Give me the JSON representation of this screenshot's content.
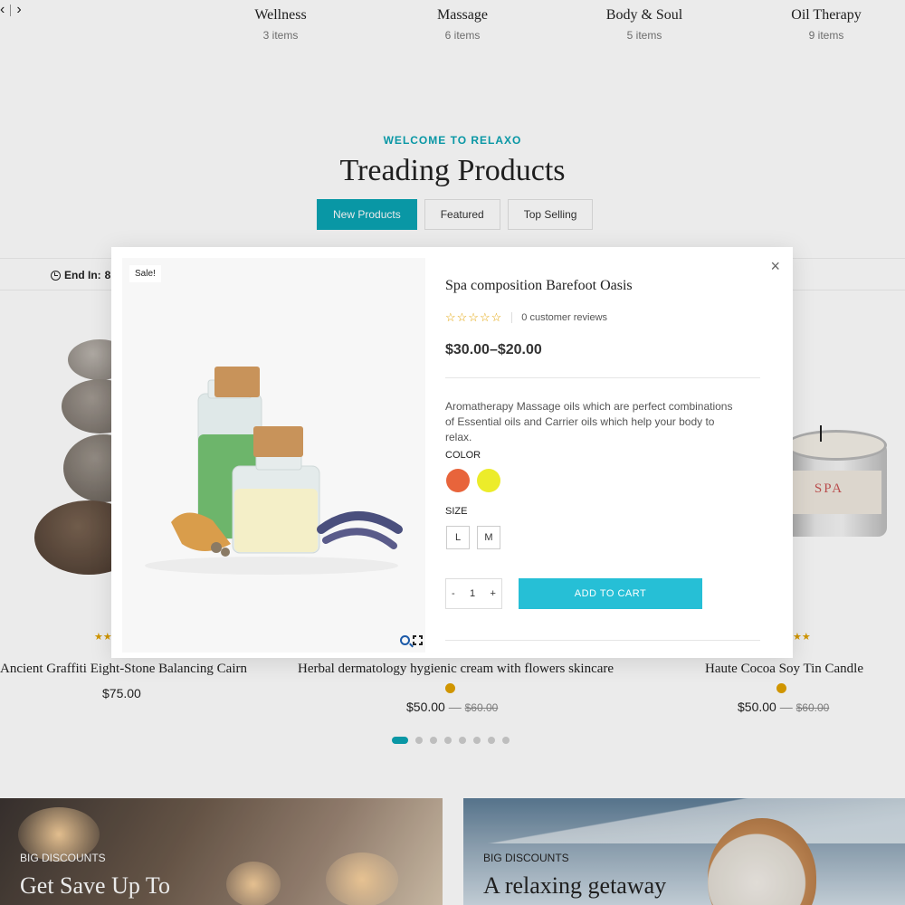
{
  "categories": [
    {
      "name": "Wellness",
      "count": "3 items"
    },
    {
      "name": "Massage",
      "count": "6 items"
    },
    {
      "name": "Body & Soul",
      "count": "5 items"
    },
    {
      "name": "Oil Therapy",
      "count": "9 items"
    }
  ],
  "section": {
    "eyebrow": "WELCOME TO RELAXO",
    "title": "Treading Products",
    "tabs": [
      "New Products",
      "Featured",
      "Top Selling"
    ],
    "active_tab": "New Products"
  },
  "deal": {
    "end_in_label": "End In:",
    "end_in_value": "8"
  },
  "products": [
    {
      "name": "Ancient Graffiti Eight-Stone Balancing Cairn",
      "price": "$75.00"
    },
    {
      "name": "Herbal dermatology hygienic cream with flowers skincare",
      "price": "$50.00",
      "separator": "—",
      "old_price": "$60.00"
    },
    {
      "name": "Haute Cocoa Soy Tin Candle",
      "price": "$50.00",
      "separator": "—",
      "old_price": "$60.00"
    }
  ],
  "candle_label": "SPA",
  "banners": [
    {
      "eyebrow": "BIG DISCOUNTS",
      "headline": "Get Save Up To"
    },
    {
      "eyebrow": "BIG DISCOUNTS",
      "headline": "A relaxing getaway"
    }
  ],
  "quickview": {
    "badge": "Sale!",
    "title": "Spa composition Barefoot Oasis",
    "stars": "☆☆☆☆☆",
    "reviews": "0 customer reviews",
    "price": "$30.00–$20.00",
    "description": "Aromatherapy Massage oils which are perfect combinations of Essential oils and Carrier oils which help your body to relax.",
    "color_label": "COLOR",
    "colors": [
      "#e8643b",
      "#ecec2a"
    ],
    "size_label": "SIZE",
    "sizes": [
      "L",
      "M"
    ],
    "qty_minus": "-",
    "qty_value": "1",
    "qty_plus": "+",
    "add_to_cart": "ADD TO CART",
    "close": "×"
  },
  "colors": {
    "accent": "#0aa4b3",
    "cart_button": "#26bfd6",
    "rating": "#e2a200"
  }
}
